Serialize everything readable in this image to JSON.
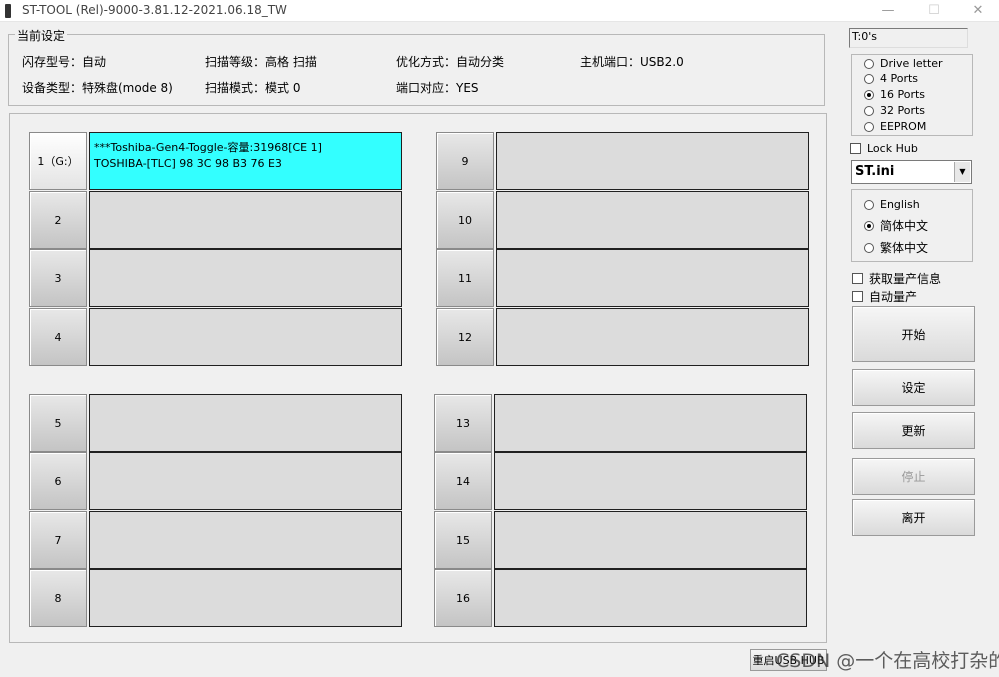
{
  "window": {
    "title": "ST-TOOL (Rel)-9000-3.81.12-2021.06.18_TW",
    "minimize": "—",
    "maximize": "☐",
    "close": "✕"
  },
  "settings": {
    "legend": "当前设定",
    "flash_type": "闪存型号：自动",
    "scan_level": "扫描等级：高格 扫描",
    "optimize": "优化方式：自动分类",
    "host_port": "主机端口：USB2.0",
    "device_type": "设备类型：特殊盘(mode 8)",
    "scan_mode": "扫描模式：模式 0",
    "port_map": "端口对应：YES"
  },
  "slots": [
    {
      "label": "1（G:）",
      "line1": "***Toshiba-Gen4-Toggle-容量:31968[CE 1]",
      "line2": "TOSHIBA-[TLC] 98 3C 98 B3 76 E3"
    },
    {
      "label": "2",
      "line1": "",
      "line2": ""
    },
    {
      "label": "3",
      "line1": "",
      "line2": ""
    },
    {
      "label": "4",
      "line1": "",
      "line2": ""
    },
    {
      "label": "5",
      "line1": "",
      "line2": ""
    },
    {
      "label": "6",
      "line1": "",
      "line2": ""
    },
    {
      "label": "7",
      "line1": "",
      "line2": ""
    },
    {
      "label": "8",
      "line1": "",
      "line2": ""
    },
    {
      "label": "9",
      "line1": "",
      "line2": ""
    },
    {
      "label": "10",
      "line1": "",
      "line2": ""
    },
    {
      "label": "11",
      "line1": "",
      "line2": ""
    },
    {
      "label": "12",
      "line1": "",
      "line2": ""
    },
    {
      "label": "13",
      "line1": "",
      "line2": ""
    },
    {
      "label": "14",
      "line1": "",
      "line2": ""
    },
    {
      "label": "15",
      "line1": "",
      "line2": ""
    },
    {
      "label": "16",
      "line1": "",
      "line2": ""
    }
  ],
  "status": "T:0's",
  "port_options": [
    {
      "label": "Drive letter",
      "checked": false
    },
    {
      "label": "4 Ports",
      "checked": false
    },
    {
      "label": "16 Ports",
      "checked": true
    },
    {
      "label": "32 Ports",
      "checked": false
    },
    {
      "label": "EEPROM",
      "checked": false
    }
  ],
  "lock_hub": "Lock Hub",
  "ini_file": "ST.ini",
  "language_options": [
    {
      "label": "English",
      "checked": false
    },
    {
      "label": "简体中文",
      "checked": true
    },
    {
      "label": "繁体中文",
      "checked": false
    }
  ],
  "get_info": "获取量产信息",
  "auto_produce": "自动量产",
  "buttons": {
    "start": "开始",
    "settings": "设定",
    "update": "更新",
    "stop": "停止",
    "exit": "离开"
  },
  "restart_hub": "重启USB HUB",
  "watermark": "CSDN @一个在高校打杂的",
  "colors": {
    "active_slot": "#33ffff",
    "slot_bg": "#dcdcdc"
  }
}
